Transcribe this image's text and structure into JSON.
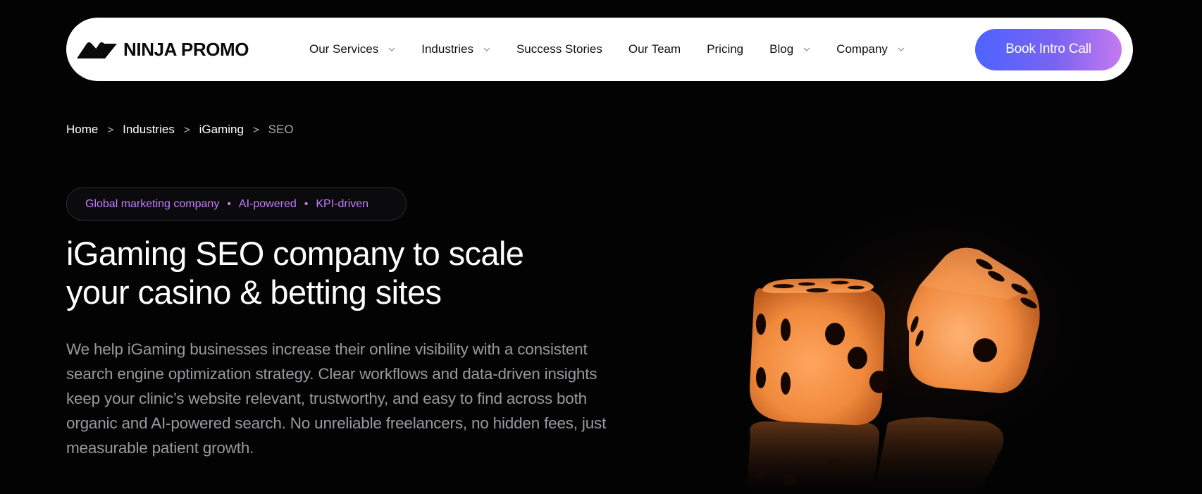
{
  "nav": {
    "logo_text": "NINJA PROMO",
    "items": [
      {
        "label": "Our Services",
        "has_dropdown": true
      },
      {
        "label": "Industries",
        "has_dropdown": true
      },
      {
        "label": "Success Stories",
        "has_dropdown": false
      },
      {
        "label": "Our Team",
        "has_dropdown": false
      },
      {
        "label": "Pricing",
        "has_dropdown": false
      },
      {
        "label": "Blog",
        "has_dropdown": true
      },
      {
        "label": "Company",
        "has_dropdown": true
      }
    ],
    "cta_label": "Book Intro Call"
  },
  "breadcrumb": {
    "items": [
      "Home",
      "Industries",
      "iGaming"
    ],
    "current": "SEO",
    "separator": ">"
  },
  "pill": {
    "tags": [
      "Global marketing company",
      "AI-powered",
      "KPI-driven"
    ],
    "separator": "•"
  },
  "hero": {
    "headline_line1": "iGaming SEO company to scale",
    "headline_line2": "your casino & betting sites",
    "description": "We help iGaming businesses increase their online visibility with a consistent search engine optimization strategy. Clear workflows and data-driven insights keep your clinic’s website relevant, trustworthy, and easy to find across both organic and AI-powered search. No unreliable freelancers, no hidden fees, just measurable patient growth."
  },
  "colors": {
    "background": "#030304",
    "accent_purple": "#c77dff",
    "cta_gradient_start": "#4e63ff",
    "cta_gradient_end": "#c47af0",
    "dice": "#f08a3c"
  },
  "image": {
    "icon": "dice-image"
  }
}
